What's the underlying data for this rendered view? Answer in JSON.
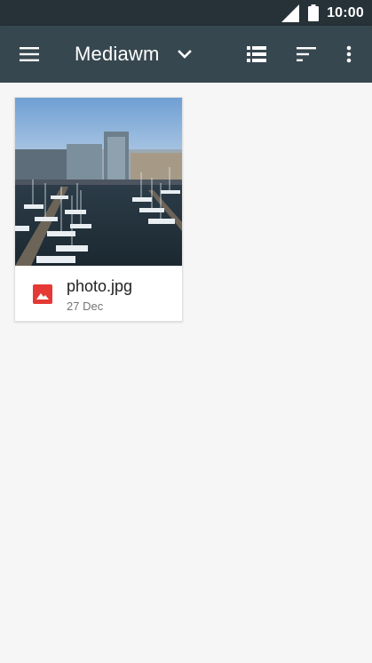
{
  "status_bar": {
    "time": "10:00",
    "icons": [
      "signal-icon",
      "battery-icon"
    ]
  },
  "app_bar": {
    "title": "Mediawm",
    "icons": [
      "menu-icon",
      "chevron-down-icon",
      "list-view-icon",
      "sort-icon",
      "more-vert-icon"
    ]
  },
  "files": [
    {
      "name": "photo.jpg",
      "date": "27 Dec",
      "type_icon": "image-icon",
      "type_color": "#e53935"
    }
  ],
  "colors": {
    "status_bar": "#263238",
    "app_bar": "#37474f",
    "background": "#f6f6f6"
  }
}
